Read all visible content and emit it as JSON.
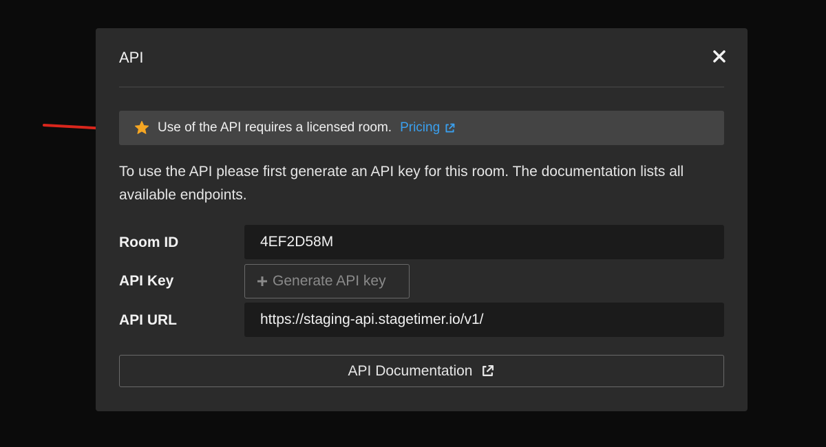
{
  "modal": {
    "title": "API"
  },
  "notice": {
    "text": "Use of the API requires a licensed room.",
    "link_label": "Pricing"
  },
  "description": "To use the API please first generate an API key for this room. The documentation lists all available endpoints.",
  "fields": {
    "room_id": {
      "label": "Room ID",
      "value": "4EF2D58M"
    },
    "api_key": {
      "label": "API Key",
      "button_label": "Generate API key"
    },
    "api_url": {
      "label": "API URL",
      "value": "https://staging-api.stagetimer.io/v1/"
    }
  },
  "documentation_button": {
    "label": "API Documentation"
  },
  "icons": {
    "close": "close-icon",
    "star": "star-icon",
    "external_link": "external-link-icon",
    "plus": "plus-icon",
    "annotation_arrow": "arrow-icon"
  },
  "colors": {
    "backdrop": "#0b0b0b",
    "modal_bg": "#2b2b2b",
    "notice_bg": "#444444",
    "field_bg": "#1b1b1b",
    "link": "#3aa0ef",
    "star": "#f5a623",
    "annotation_arrow": "#d9261c"
  }
}
